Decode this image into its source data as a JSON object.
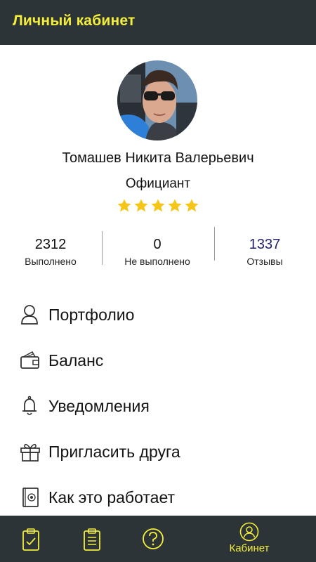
{
  "header": {
    "title": "Личный кабинет"
  },
  "profile": {
    "name": "Томашев Никита Валерьевич",
    "role": "Официант",
    "rating": 5,
    "rating_max": 5
  },
  "stats": [
    {
      "value": "2312",
      "label": "Выполнено"
    },
    {
      "value": "0",
      "label": "Не выполнено"
    },
    {
      "value": "1337",
      "label": "Отзывы"
    }
  ],
  "menu": [
    {
      "label": "Портфолио",
      "icon": "user-icon"
    },
    {
      "label": "Баланс",
      "icon": "wallet-icon"
    },
    {
      "label": "Уведомления",
      "icon": "bell-icon"
    },
    {
      "label": "Пригласить друга",
      "icon": "gift-icon"
    },
    {
      "label": "Как это работает",
      "icon": "info-book-icon"
    }
  ],
  "bottom_nav": [
    {
      "icon": "clipboard-check-icon"
    },
    {
      "icon": "clipboard-list-icon"
    },
    {
      "icon": "help-circle-icon"
    },
    {
      "icon": "profile-icon",
      "label": "Кабинет",
      "active": true
    }
  ],
  "colors": {
    "bar_background": "#2c3437",
    "accent_yellow": "#f4ee3b",
    "star": "#f5c518",
    "reviews_value": "#1f1f6e"
  }
}
